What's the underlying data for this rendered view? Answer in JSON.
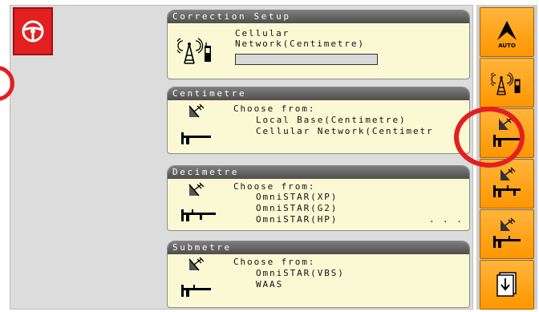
{
  "correction_setup": {
    "title": "Correction Setup",
    "line1": "Cellular",
    "line2": "Network(Centimetre)"
  },
  "centimetre": {
    "title": "Centimetre",
    "choose": "Choose from:",
    "options": [
      "Local Base(Centimetre)",
      "Cellular Network(Centimetr"
    ]
  },
  "decimetre": {
    "title": "Decimetre",
    "choose": "Choose from:",
    "options": [
      "OmniSTAR(XP)",
      "OmniSTAR(G2)",
      "OmniSTAR(HP)"
    ],
    "more": ". . ."
  },
  "submetre": {
    "title": "Submetre",
    "choose": "Choose from:",
    "options": [
      "OmniSTAR(VBS)",
      "WAAS"
    ]
  },
  "sidebar": {
    "auto_label": "AUTO"
  },
  "colors": {
    "accent_orange": "#ff9c0d",
    "alert_red": "#e41f1f",
    "card_bg": "#fbf9d3"
  },
  "icons": {
    "steering": "steering-wheel-icon",
    "auto_steer": "auto-steer-icon",
    "cell_tower": "cell-tower-icon",
    "satellite": "satellite-dish-icon",
    "caliper": "caliper-icon",
    "scroll_down": "scroll-down-icon"
  }
}
